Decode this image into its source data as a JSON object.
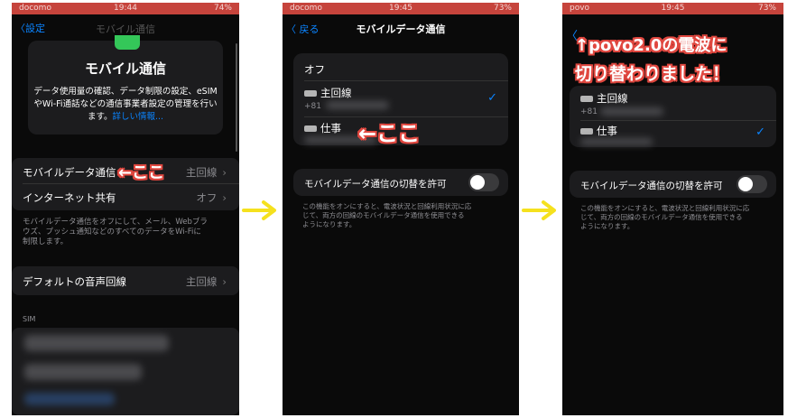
{
  "panel1": {
    "status": {
      "carrier": "docomo",
      "time": "19:44",
      "battery": "74%"
    },
    "back_label": "設定",
    "nav_title": "モバイル通信",
    "header_title": "モバイル通信",
    "header_desc_lines": [
      "データ使用量の確認、データ制限の設定、eSIM",
      "やWi-Fi通話などの通信事業者設定の管理を行い"
    ],
    "header_desc_last": "ます。",
    "header_link": "詳しい情報...",
    "rows": [
      {
        "label": "モバイルデータ通信",
        "value": "主回線"
      },
      {
        "label": "インターネット共有",
        "value": "オフ"
      }
    ],
    "annotation": "←ここ",
    "footer_lines": [
      "モバイルデータ通信をオフにして、メール、Webブラ",
      "ウズ、プッシュ通知などのすべてのデータをWi-Fiに",
      "制限します。"
    ],
    "voice_row": {
      "label": "デフォルトの音声回線",
      "value": "主回線"
    },
    "sim_header": "SIM"
  },
  "panel2": {
    "status": {
      "carrier": "docomo",
      "time": "19:45",
      "battery": "73%"
    },
    "back_label": "戻る",
    "title": "モバイルデータ通信",
    "option_off": "オフ",
    "line_main": {
      "badge": "主回線",
      "label": "主回線",
      "number": "+81"
    },
    "line_work": {
      "badge": "仕事",
      "label": "仕事"
    },
    "annotation": "←ここ",
    "switch_label": "モバイルデータ通信の切替を許可",
    "footer_lines": [
      "この機能をオンにすると、電波状況と回線利用状況に応",
      "じて、両方の回線のモバイルデータ通信を使用できる",
      "ようになります。"
    ]
  },
  "panel3": {
    "status": {
      "carrier": "povo",
      "time": "19:45",
      "battery": "73%"
    },
    "annotation_line1": "↑povo2.0の電波に",
    "annotation_line2": "切り替わりました！",
    "line_main": {
      "label": "主回線",
      "number": "+81"
    },
    "line_work": {
      "label": "仕事"
    },
    "switch_label": "モバイルデータ通信の切替を許可",
    "footer_lines": [
      "この機能をオンにすると、電波状況と回線利用状況に応",
      "じて、両方の回線のモバイルデータ通信を使用できる",
      "ようになります。"
    ]
  },
  "colors": {
    "annotation_red": "#e0473f",
    "arrow_yellow": "#f5e11e",
    "accent_blue": "#0a84ff",
    "status_red": "#c6443c"
  }
}
